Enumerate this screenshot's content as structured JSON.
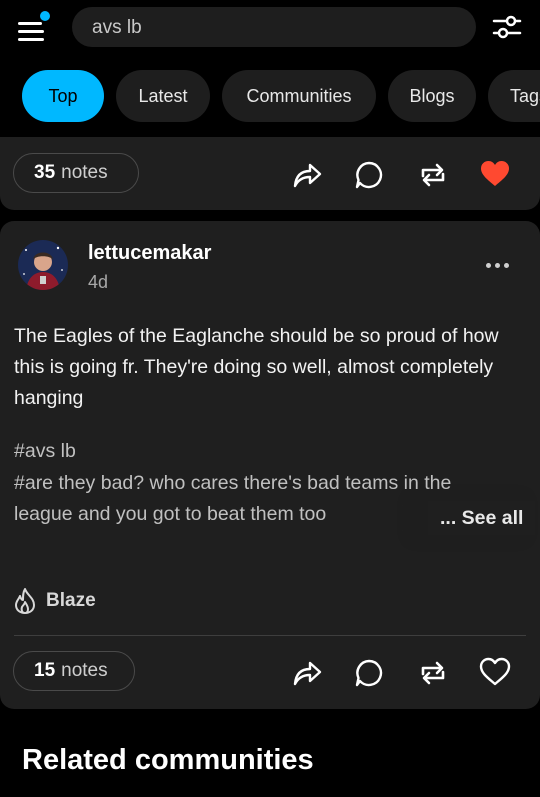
{
  "search": {
    "query": "avs lb"
  },
  "tabs": [
    {
      "label": "Top",
      "active": true
    },
    {
      "label": "Latest",
      "active": false
    },
    {
      "label": "Communities",
      "active": false
    },
    {
      "label": "Blogs",
      "active": false
    },
    {
      "label": "Tags",
      "active": false
    }
  ],
  "prev_post": {
    "notes_count": "35",
    "notes_word": "notes",
    "liked": true
  },
  "post": {
    "username": "lettucemakar",
    "time": "4d",
    "body": "The Eagles of the Eaglanche should be so proud of how this is going fr. They're doing so well, almost completely hanging",
    "tags": [
      "#avs lb",
      "#are they bad? who cares there's bad teams in the league and you got to beat them too"
    ],
    "see_all": "... See all",
    "blaze_label": "Blaze",
    "notes_count": "15",
    "notes_word": "notes",
    "liked": false
  },
  "related": {
    "heading": "Related communities"
  },
  "colors": {
    "accent": "#00b8ff",
    "like": "#ff4930",
    "card": "#1f1f1f",
    "background": "#000000"
  },
  "icons": [
    "menu-icon",
    "filter-icon",
    "share-icon",
    "reply-icon",
    "reblog-icon",
    "heart-icon",
    "more-icon",
    "blaze-icon"
  ]
}
